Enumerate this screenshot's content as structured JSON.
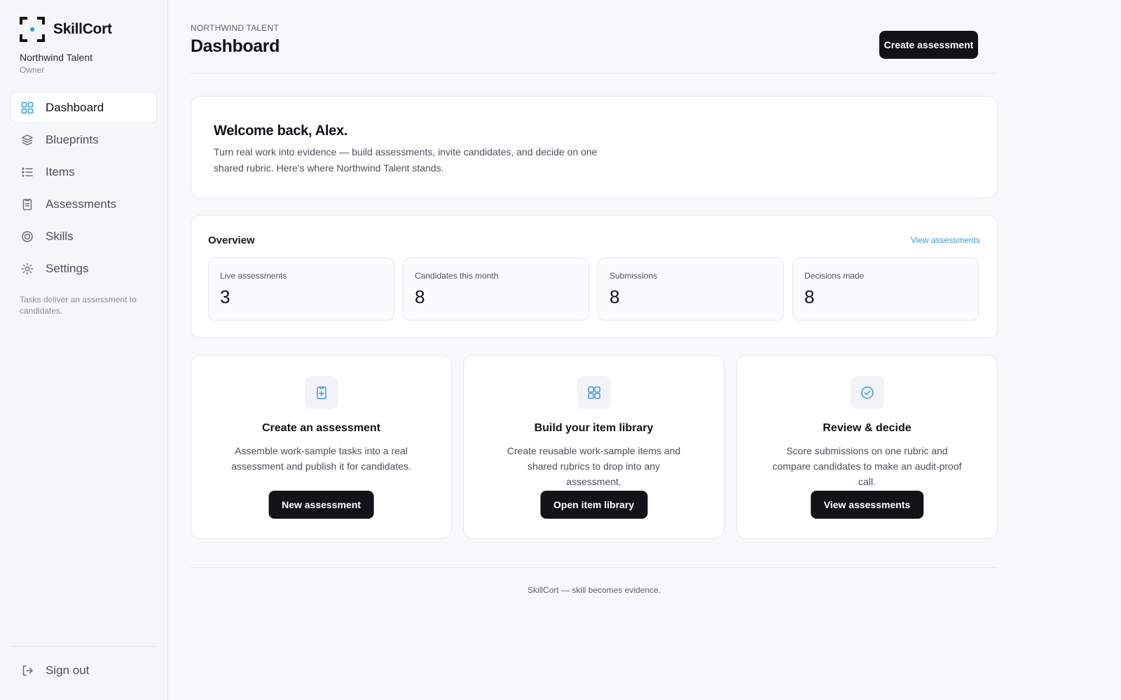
{
  "brand": {
    "name": "SkillCort",
    "icon": "focus-frame-logo",
    "accent": "#3b9ae1"
  },
  "org": {
    "name": "Northwind Talent",
    "role": "Owner"
  },
  "sidebar": {
    "items": [
      {
        "label": "Dashboard",
        "icon": "grid-icon",
        "active": true
      },
      {
        "label": "Blueprints",
        "icon": "layers-icon"
      },
      {
        "label": "Items",
        "icon": "list-icon"
      },
      {
        "label": "Assessments",
        "icon": "clipboard-icon"
      },
      {
        "label": "Skills",
        "icon": "target-icon"
      },
      {
        "label": "Settings",
        "icon": "sun-gear-icon"
      }
    ],
    "note": "Tasks deliver an assessment to candidates.",
    "signout_label": "Sign out"
  },
  "header": {
    "eyebrow": "NORTHWIND TALENT",
    "title": "Dashboard",
    "create_button": "Create assessment"
  },
  "welcome": {
    "title": "Welcome back, Alex.",
    "body": "Turn real work into evidence — build assessments, invite candidates, and decide on one shared rubric. Here's where Northwind Talent stands."
  },
  "overview": {
    "title": "Overview",
    "link": "View assessments",
    "stats": [
      {
        "label": "Live assessments",
        "value": "3"
      },
      {
        "label": "Candidates this month",
        "value": "8"
      },
      {
        "label": "Submissions",
        "value": "8"
      },
      {
        "label": "Decisions made",
        "value": "8"
      }
    ]
  },
  "actions": [
    {
      "title": "Create an assessment",
      "body": "Assemble work-sample tasks into a real assessment and publish it for candidates.",
      "button": "New assessment",
      "icon": "clipboard-plus-icon"
    },
    {
      "title": "Build your item library",
      "body": "Create reusable work-sample items and shared rubrics to drop into any assessment.",
      "button": "Open item library",
      "icon": "grid-icon"
    },
    {
      "title": "Review & decide",
      "body": "Score submissions on one rubric and compare candidates to make an audit-proof call.",
      "button": "View assessments",
      "icon": "check-circle-icon"
    }
  ],
  "footer": {
    "text": "SkillCort — skill becomes evidence."
  }
}
